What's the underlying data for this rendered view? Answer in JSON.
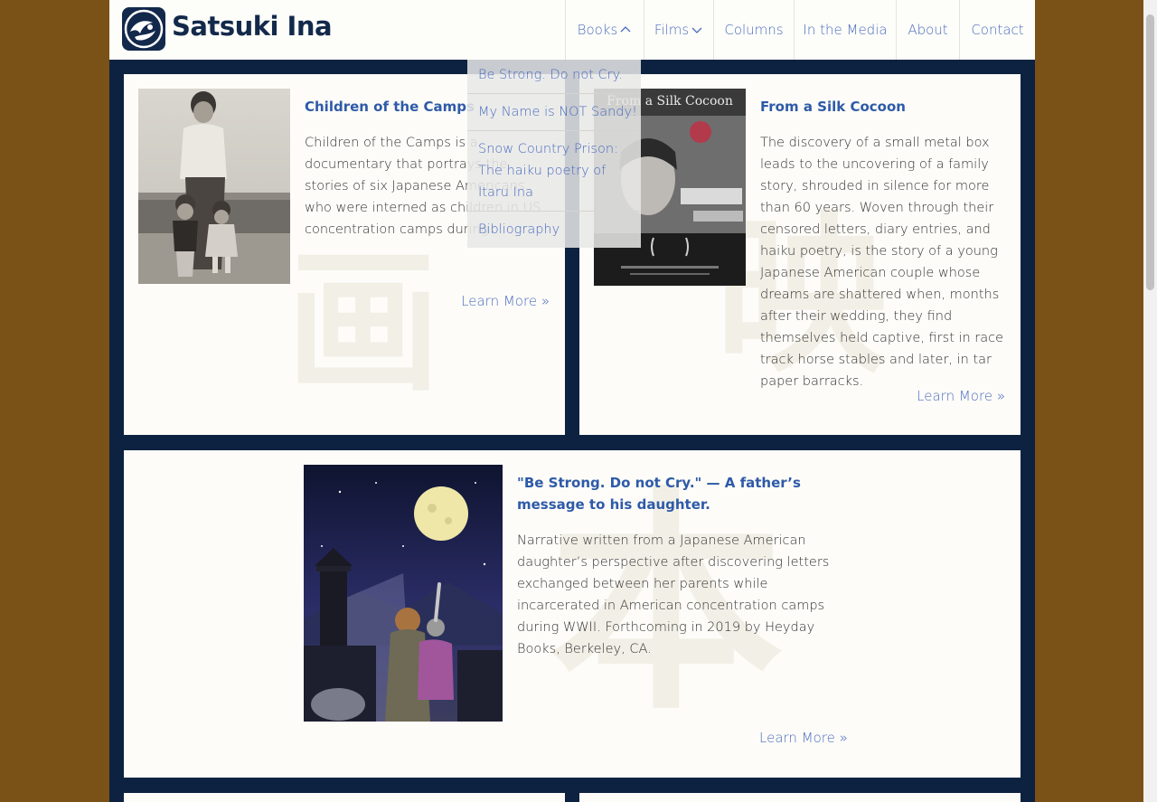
{
  "site": {
    "title": "Satsuki Ina",
    "logo": "satsuki-ina-logo"
  },
  "nav": {
    "items": [
      {
        "label": "Books",
        "icon": "chevron-up-icon"
      },
      {
        "label": "Films",
        "icon": "chevron-down-icon"
      },
      {
        "label": "Columns"
      },
      {
        "label": "In the Media"
      },
      {
        "label": "About"
      },
      {
        "label": "Contact"
      }
    ]
  },
  "books_menu": {
    "items": [
      "Be Strong. Do not Cry.",
      "My Name is NOT Sandy!",
      "Snow Country Prison: The haiku poetry of Itaru Ina",
      "Bibliography"
    ]
  },
  "cards": {
    "camps": {
      "title": "Children of the Camps",
      "body": "Children of the Camps is a documentary that portrays the stories of six Japanese Americans who were interned as children in US concentration camps during",
      "link": "Learn More »"
    },
    "cocoon": {
      "title": "From a Silk Cocoon",
      "body": "The discovery of a small metal box leads to the uncovering of a family story, shrouded in silence for more than 60 years. Woven through their censored letters, diary entries, and haiku poetry, is the story of a young Japanese American couple whose dreams are shattered when, months after their wedding, they find themselves held captive, first in race track horse stables and later, in tar paper barracks.",
      "link": "Learn More »",
      "poster_title": "From a Silk Cocoon"
    },
    "strong": {
      "title": "\"Be Strong. Do not Cry.\" — A father’s message to his daughter.",
      "body": "Narrative written from a Japanese American daughter’s perspective after discovering letters exchanged between her parents while incarcerated in American concentration camps during WWII. Forthcoming in 2019 by Heyday Books, Berkeley, CA.",
      "link": "Learn More »"
    }
  },
  "colors": {
    "navy": "#0d2240",
    "link": "#4a6cc0",
    "title": "#2e5aa8",
    "card": "#fdfcf8",
    "outer": "#7a5116"
  }
}
